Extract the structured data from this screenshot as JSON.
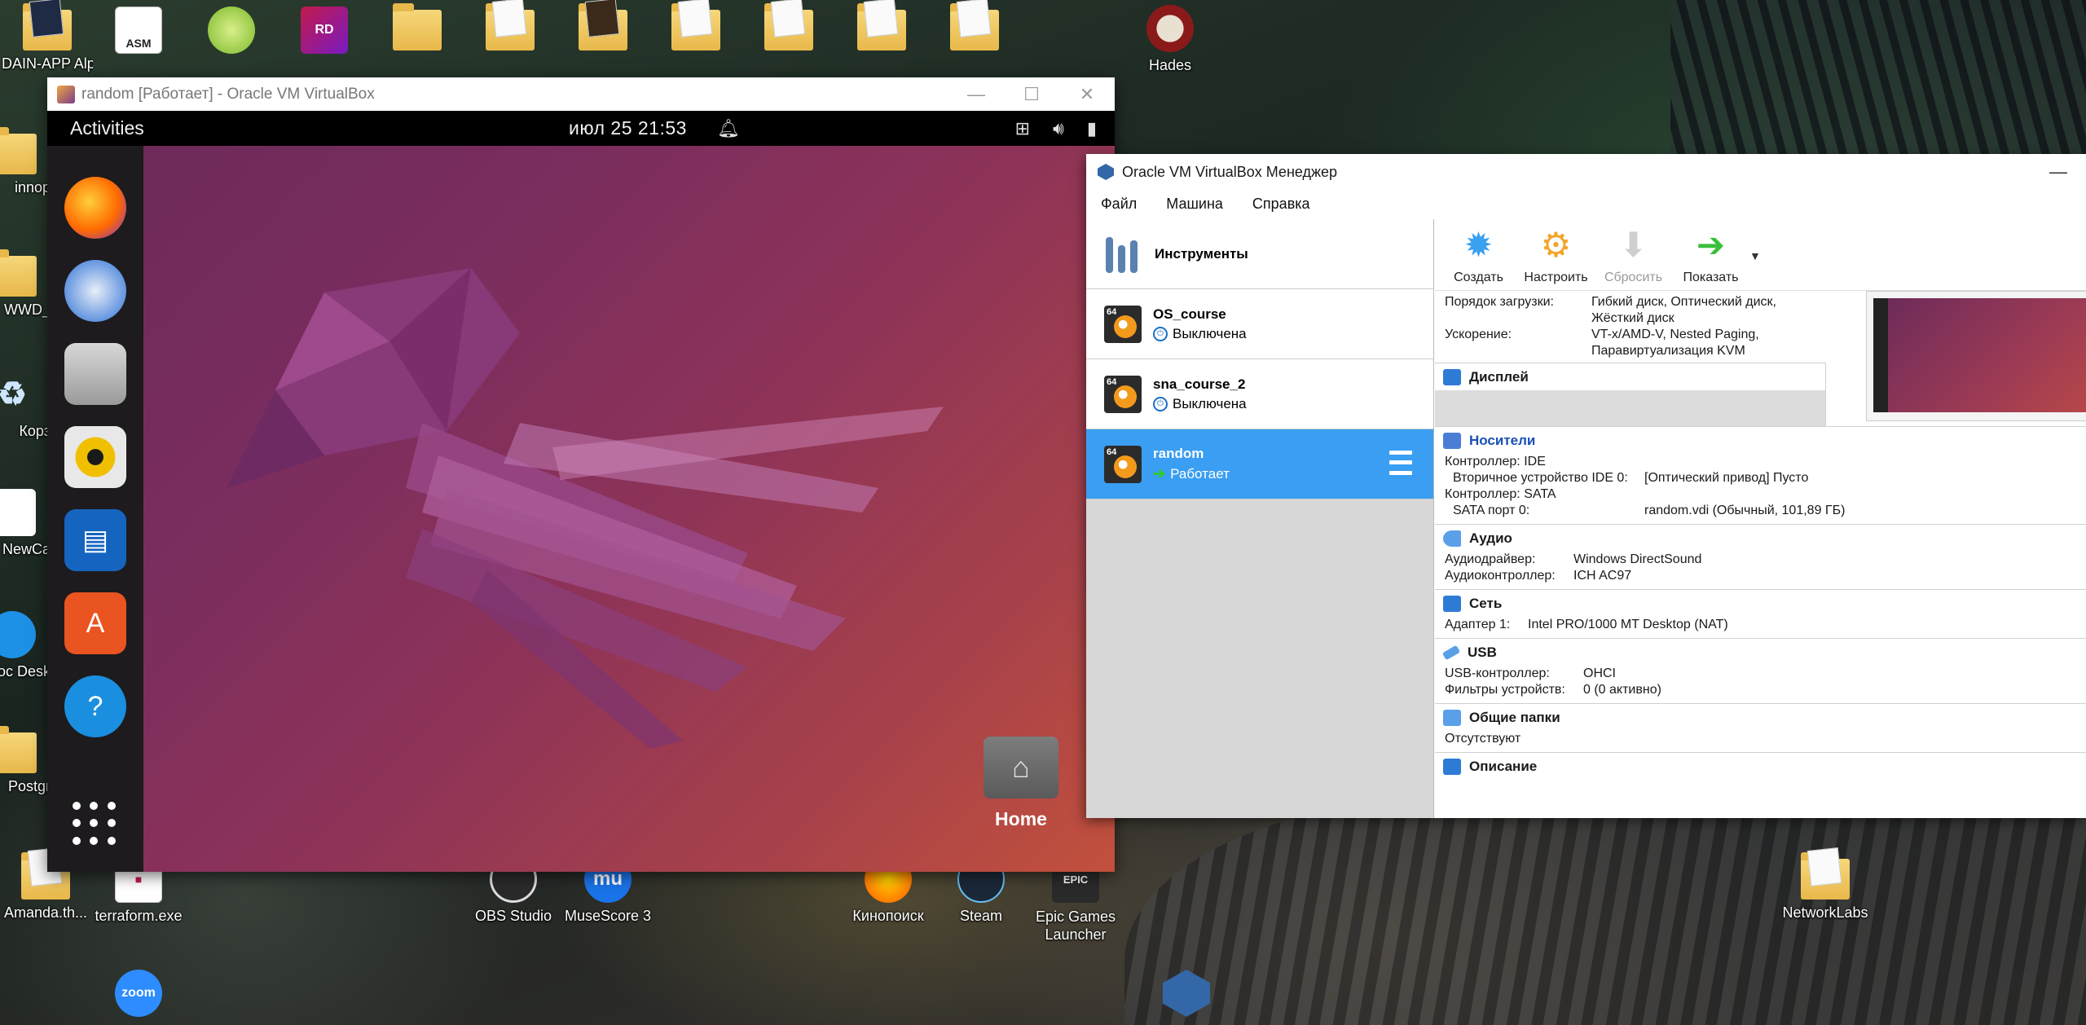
{
  "desktop": {
    "icons_top": [
      {
        "label": "DAIN-APP Alph",
        "glyph": "folder"
      },
      {
        "label": "",
        "glyph": "ASM"
      },
      {
        "label": "",
        "glyph": "lime"
      },
      {
        "label": "",
        "glyph": "RD"
      },
      {
        "label": "",
        "glyph": "folder"
      },
      {
        "label": "",
        "glyph": "folder"
      },
      {
        "label": "",
        "glyph": "folder"
      },
      {
        "label": "",
        "glyph": "folder"
      },
      {
        "label": "",
        "glyph": "folder"
      },
      {
        "label": "",
        "glyph": "folder"
      },
      {
        "label": "",
        "glyph": "folder"
      }
    ],
    "hades_label": "Hades",
    "left_column": [
      "innop",
      "WWD_",
      "Корз",
      "NewCa",
      "Doc Desk",
      "Postgr"
    ],
    "bottom_row": [
      {
        "label": "Amanda.th...",
        "glyph": "folder"
      },
      {
        "label": "terraform.exe",
        "glyph": "terraform"
      },
      {
        "label": "OBS Studio",
        "glyph": "obs"
      },
      {
        "label": "MuseScore 3",
        "glyph": "mu"
      },
      {
        "label": "Кинопоиск",
        "glyph": "kino"
      },
      {
        "label": "Steam",
        "glyph": "steam"
      },
      {
        "label": "Epic Games Launcher",
        "glyph": "epic"
      },
      {
        "label": "NetworkLabs",
        "glyph": "folder"
      }
    ],
    "zoom_label": "zoom"
  },
  "vm_window": {
    "title": "random [Работает] - Oracle VM VirtualBox",
    "controls": {
      "minimize": "—",
      "maximize": "☐",
      "close": "✕"
    }
  },
  "guest": {
    "activities": "Activities",
    "clock": "июл 25  21:53",
    "bell_icon": "bell-icon",
    "dock_apps": [
      "firefox",
      "thunderbird",
      "files",
      "rhythmbox",
      "writer",
      "app-center",
      "help"
    ],
    "home_label": "Home"
  },
  "manager": {
    "title": "Oracle VM VirtualBox Менеджер",
    "menu": [
      "Файл",
      "Машина",
      "Справка"
    ],
    "tools_label": "Инструменты",
    "vms": [
      {
        "name": "OS_course",
        "state": "Выключена",
        "running": false
      },
      {
        "name": "sna_course_2",
        "state": "Выключена",
        "running": false
      },
      {
        "name": "random",
        "state": "Работает",
        "running": true
      }
    ],
    "toolbar": [
      {
        "label": "Создать",
        "icon": "create-icon",
        "enabled": true
      },
      {
        "label": "Настроить",
        "icon": "settings-icon",
        "enabled": true
      },
      {
        "label": "Сбросить",
        "icon": "discard-icon",
        "enabled": false
      },
      {
        "label": "Показать",
        "icon": "show-icon",
        "enabled": true
      }
    ],
    "system": {
      "boot_order_key": "Порядок загрузки:",
      "boot_order_val": "Гибкий диск, Оптический диск,",
      "boot_order_val2": "Жёсткий диск",
      "accel_key": "Ускорение:",
      "accel_val": "VT-x/AMD-V, Nested Paging,",
      "accel_val2": "Паравиртуализация KVM"
    },
    "display": {
      "title": "Дисплей"
    },
    "storage": {
      "title": "Носители",
      "ctrl_ide": "Контроллер: IDE",
      "ide_dev_key": "Вторичное устройство IDE 0:",
      "ide_dev_val": "[Оптический привод] Пусто",
      "ctrl_sata": "Контроллер: SATA",
      "sata_key": "SATA порт 0:",
      "sata_val": "random.vdi (Обычный, 101,89 ГБ)"
    },
    "audio": {
      "title": "Аудио",
      "driver_key": "Аудиодрайвер:",
      "driver_val": "Windows DirectSound",
      "ctrl_key": "Аудиоконтроллер:",
      "ctrl_val": "ICH AC97"
    },
    "network": {
      "title": "Сеть",
      "adapter_key": "Адаптер 1:",
      "adapter_val": "Intel PRO/1000 MT Desktop (NAT)"
    },
    "usb": {
      "title": "USB",
      "ctrl_key": "USB-контроллер:",
      "ctrl_val": "OHCI",
      "filters_key": "Фильтры устройств:",
      "filters_val": "0 (0 активно)"
    },
    "shared": {
      "title": "Общие папки",
      "value": "Отсутствуют"
    },
    "description": {
      "title": "Описание"
    }
  },
  "colors": {
    "selected_vm": "#3a9ef2",
    "vm_bg": "#7a2d5e",
    "section_icon": "#2e7bd6"
  }
}
